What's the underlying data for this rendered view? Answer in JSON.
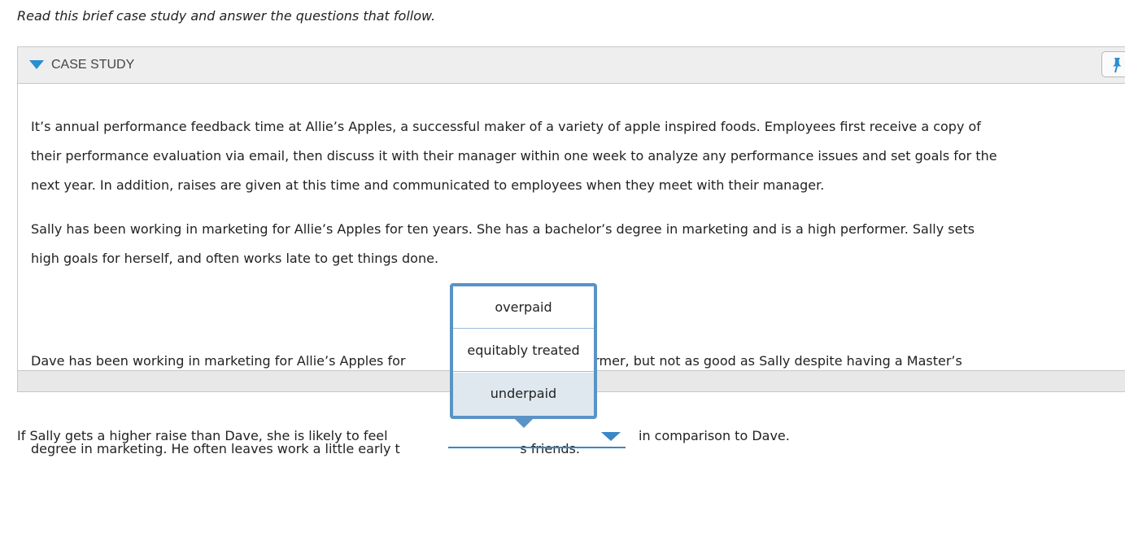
{
  "instructions": "Read this brief case study and answer the questions that follow.",
  "case_study": {
    "header_label": "CASE STUDY",
    "paragraphs": [
      {
        "lines": [
          "It’s annual performance feedback time at Allie’s Apples, a successful maker of a variety of apple inspired foods. Employees first receive a copy of",
          "their performance evaluation via email, then discuss it with their manager within one week to analyze any performance issues and set goals for the",
          "next year. In addition, raises are given at this time and communicated to employees when they meet with their manager."
        ]
      },
      {
        "lines": [
          "Sally has been working in marketing for Allie’s Apples for ten years. She has a bachelor’s degree in marketing and is a high performer. Sally sets",
          "high goals for herself, and often works late to get things done."
        ]
      },
      {
        "lines": [
          "Dave has been working in marketing for Allie’s Apples for                             solid performer, but not as good as Sally despite having a Master’s",
          "degree in marketing. He often leaves work a little early t                             s friends."
        ]
      }
    ]
  },
  "question": {
    "before": "If Sally gets a higher raise than Dave, she is likely to feel",
    "after": "in comparison to Dave.",
    "selected_value": ""
  },
  "dropdown_options": [
    "overpaid",
    "equitably treated",
    "underpaid"
  ],
  "colors": {
    "accent": "#3a86c8",
    "popup_border": "#5a93c5",
    "hover_option_bg": "#dfe8ee",
    "header_bg": "#eeeeee"
  }
}
